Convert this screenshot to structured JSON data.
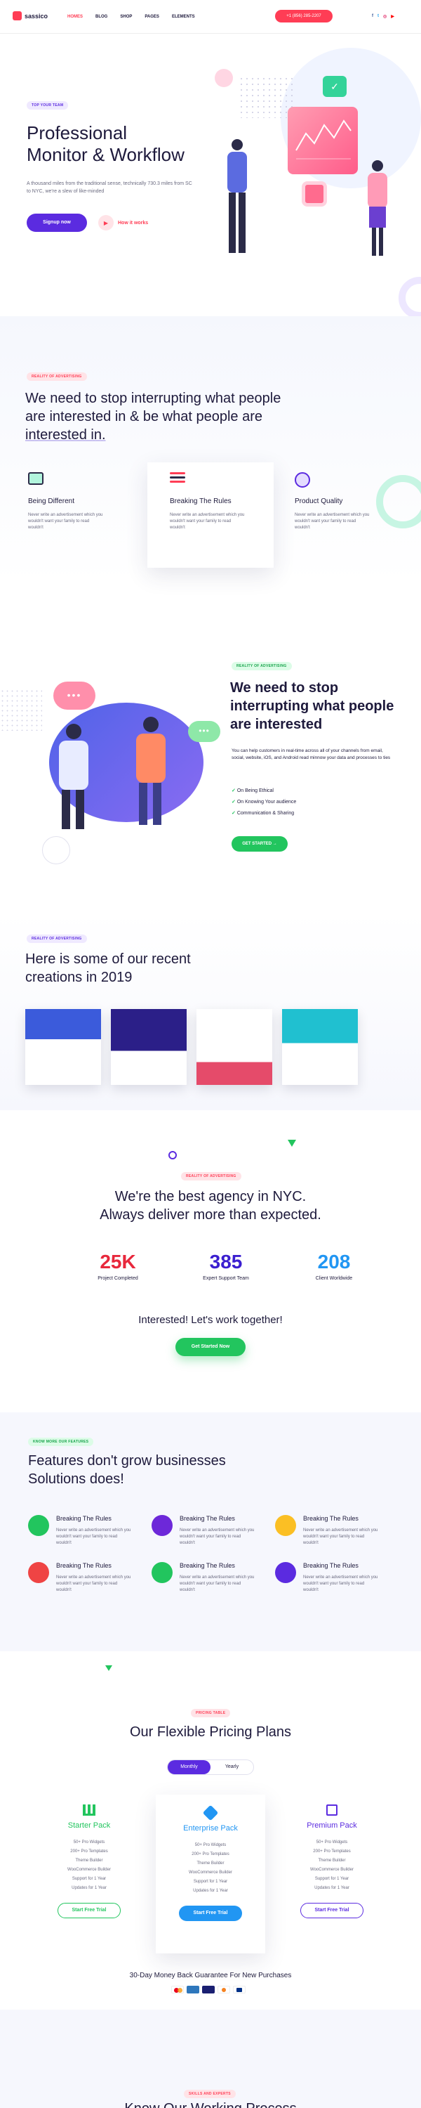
{
  "header": {
    "logo_text": "sassico",
    "nav": [
      "HOMES",
      "BLOG",
      "SHOP",
      "PAGES",
      "ELEMENTS"
    ],
    "phone": "+1 (856) 285-2207",
    "colors": {
      "primary": "#5b2be0",
      "accent": "#ff3d55",
      "green": "#22c55e"
    }
  },
  "hero": {
    "badge": "TOP YOUR TEAM",
    "title_line1": "Professional",
    "title_line2": "Monitor & Workflow",
    "description": "A thousand miles from the traditional sense, technically 730.3 miles from SC to NYC, we're a slew of like-minded",
    "signup": "Signup now",
    "how": "How it works"
  },
  "intro": {
    "badge": "REALITY OF ADVERTISING",
    "title_line1": "We need to stop interrupting what people",
    "title_line2": "are interested in & be what people are",
    "title_line3": "interested in.",
    "cards": [
      {
        "title": "Being Different",
        "desc": "Never write an advertisement which you wouldn't want your family to read wouldn't"
      },
      {
        "title": "Breaking The Rules",
        "desc": "Never write an advertisement which you wouldn't want your family to read wouldn't"
      },
      {
        "title": "Product Quality",
        "desc": "Never write an advertisement which you wouldn't want your family to read wouldn't"
      }
    ]
  },
  "about": {
    "badge": "REALITY OF ADVERTISING",
    "title_line1": "We need to stop",
    "title_line2": "interrupting what people",
    "title_line3": "are interested",
    "desc": "You can help customers in real-time across all of your channels from email, social, website, iOS, and Android read minnow your data and processes to ties",
    "list": [
      "On Being Ethical",
      "On Knowing Your audience",
      "Communication & Sharing"
    ],
    "cta": "GET STARTED"
  },
  "creations": {
    "badge": "REALITY OF ADVERTISING",
    "title_line1": "Here is some of our recent",
    "title_line2": "creations in 2019"
  },
  "stats": {
    "badge": "REALITY OF ADVERTISING",
    "title_line1": "We're the best agency in NYC.",
    "title_line2": "Always deliver more than expected.",
    "items": [
      {
        "value": "25K",
        "label": "Project Completed",
        "color": "#e8283c"
      },
      {
        "value": "385",
        "label": "Expert Support Team",
        "color": "#3b1fd0"
      },
      {
        "value": "208",
        "label": "Client Worldwide",
        "color": "#2196f3"
      }
    ],
    "interested": "Interested! Let's work together!",
    "cta": "Get Started Now"
  },
  "features": {
    "badge": "KNOW MORE OUR FEATURES",
    "title_line1": "Features don't grow businesses",
    "title_line2": "Solutions does!",
    "items": [
      {
        "title": "Breaking The Rules",
        "desc": "Never write an advertisement which you wouldn't want your family to read wouldn't",
        "color": "#22c55e"
      },
      {
        "title": "Breaking The Rules",
        "desc": "Never write an advertisement which you wouldn't want your family to read wouldn't",
        "color": "#6d28d9"
      },
      {
        "title": "Breaking The Rules",
        "desc": "Never write an advertisement which you wouldn't want your family to read wouldn't",
        "color": "#fbbf24"
      },
      {
        "title": "Breaking The Rules",
        "desc": "Never write an advertisement which you wouldn't want your family to read wouldn't",
        "color": "#ef4444"
      },
      {
        "title": "Breaking The Rules",
        "desc": "Never write an advertisement which you wouldn't want your family to read wouldn't",
        "color": "#22c55e"
      },
      {
        "title": "Breaking The Rules",
        "desc": "Never write an advertisement which you wouldn't want your family to read wouldn't",
        "color": "#5b2be0"
      }
    ]
  },
  "pricing": {
    "badge": "PRICING TABLE",
    "title": "Our Flexible Pricing Plans",
    "toggle": [
      "Monthly",
      "Yearly"
    ],
    "plans": [
      {
        "name": "Starter Pack",
        "color": "#22c55e",
        "cta": "Start Free Trial"
      },
      {
        "name": "Enterprise Pack",
        "color": "#2196f3",
        "cta": "Start Free Trial"
      },
      {
        "name": "Premium Pack",
        "color": "#5b2be0",
        "cta": "Start Free Trial"
      }
    ],
    "features": [
      "50+ Pro Widgets",
      "200+ Pro Templates",
      "Theme Builder",
      "WooCommerce Builder",
      "Support for 1 Year",
      "Updates for 1 Year"
    ],
    "guarantee": "30-Day Money Back Guarantee For New Purchases"
  },
  "process": {
    "badge": "SKILLS AND EXPERTS",
    "title": "Know Our Working Process"
  }
}
